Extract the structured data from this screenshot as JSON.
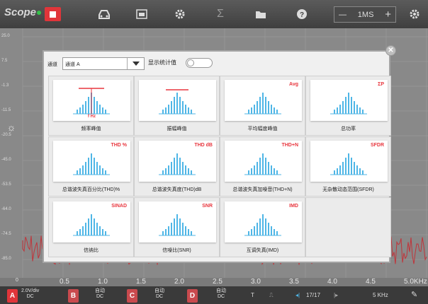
{
  "toolbar": {
    "app_name": "Scope",
    "time_div": "1MS",
    "minus": "—",
    "plus": "+"
  },
  "scope": {
    "y_labels": [
      "25.0",
      "7.5",
      "-1.3",
      "-11.5",
      "-20.5",
      "-45.0",
      "-53.5",
      "-64.0",
      "-74.5",
      "-85.0"
    ],
    "x_labels": [
      "0.5",
      "1.0",
      "1.5",
      "2.0",
      "2.5",
      "3.0",
      "3.5",
      "4.0",
      "4.5",
      "5.0KHz"
    ],
    "x_origin": "0"
  },
  "bottombar": {
    "channels": [
      {
        "letter": "A",
        "line1": "2.0V/div",
        "line2": "DC",
        "color": "#e0353a"
      },
      {
        "letter": "B",
        "line1": "自动",
        "line2": "DC",
        "color": "#c94a4e"
      },
      {
        "letter": "C",
        "line1": "自动",
        "line2": "DC",
        "color": "#c94a4e"
      },
      {
        "letter": "D",
        "line1": "自动",
        "line2": "DC",
        "color": "#c94a4e"
      }
    ],
    "page": "17/17",
    "freq": "5 KHz",
    "t_label": "T"
  },
  "modal": {
    "channel_label": "通道",
    "channel_value": "通道 A",
    "show_stats_label": "显示统计值",
    "show_stats_on": false,
    "items": [
      {
        "label": "频率峰值",
        "tag": "",
        "sub": "f Hz",
        "marker": "peak"
      },
      {
        "label": "振幅峰值",
        "tag": "",
        "sub": "",
        "marker": "amp"
      },
      {
        "label": "平均幅度峰值",
        "tag": "Avg",
        "sub": "",
        "marker": ""
      },
      {
        "label": "总功率",
        "tag": "ΣP",
        "sub": "",
        "marker": ""
      },
      {
        "label": "总谐波失真百分比(THD)%",
        "tag": "THD %",
        "sub": "",
        "marker": ""
      },
      {
        "label": "总谐波失真度(THD)dB",
        "tag": "THD dB",
        "sub": "",
        "marker": ""
      },
      {
        "label": "总谐波失真加噪音(THD+N)",
        "tag": "THD+N",
        "sub": "",
        "marker": ""
      },
      {
        "label": "无杂散动态范围(SFDR)",
        "tag": "SFDR",
        "sub": "",
        "marker": ""
      },
      {
        "label": "信纳比",
        "tag": "SINAD",
        "sub": "",
        "marker": ""
      },
      {
        "label": "信噪比(SNR)",
        "tag": "SNR",
        "sub": "",
        "marker": ""
      },
      {
        "label": "互调失真(IMD)",
        "tag": "IMD",
        "sub": "",
        "marker": ""
      }
    ]
  },
  "colors": {
    "accent": "#e0353a",
    "bar": "#4fb6e6",
    "tag": "#e8363e"
  },
  "icons": [
    "car-icon",
    "screenshot-icon",
    "gear-icon",
    "sigma-icon",
    "folder-icon",
    "help-icon",
    "settings-icon",
    "close-icon",
    "marker-icon"
  ]
}
